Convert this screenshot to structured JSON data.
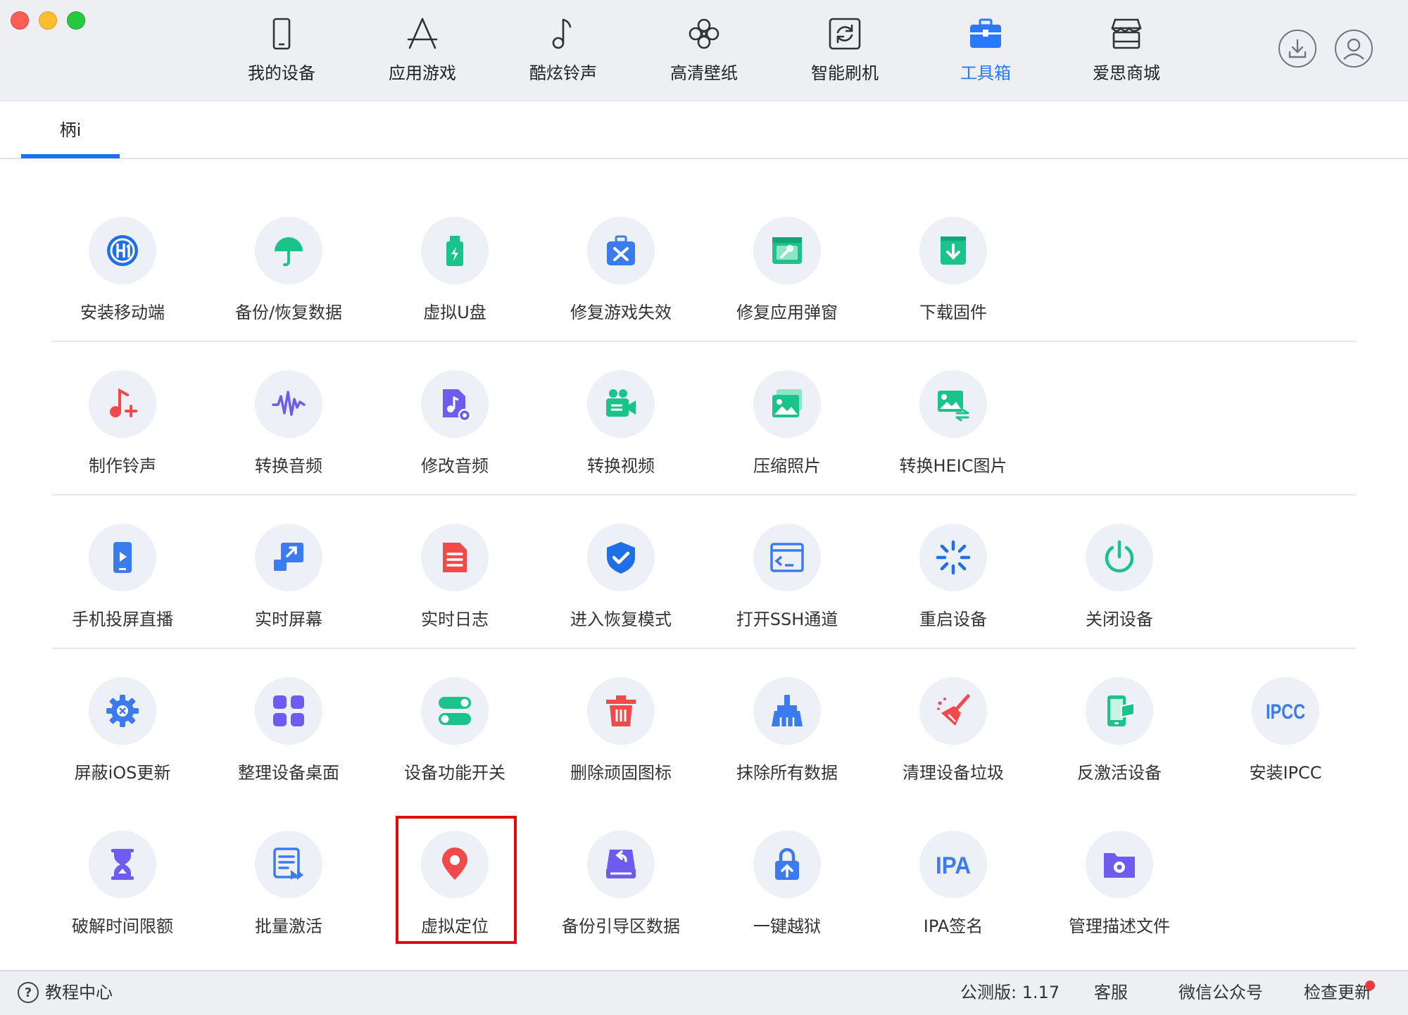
{
  "nav": {
    "items": [
      {
        "label": "我的设备",
        "icon": "phone-icon"
      },
      {
        "label": "应用游戏",
        "icon": "app-store-icon"
      },
      {
        "label": "酷炫铃声",
        "icon": "music-note-icon"
      },
      {
        "label": "高清壁纸",
        "icon": "flower-icon"
      },
      {
        "label": "智能刷机",
        "icon": "refresh-box-icon"
      },
      {
        "label": "工具箱",
        "icon": "toolbox-icon",
        "active": true
      },
      {
        "label": "爱思商城",
        "icon": "store-icon"
      }
    ],
    "active_color": "#2979ff"
  },
  "header_icons": [
    "download-icon",
    "user-avatar-icon"
  ],
  "tabs": [
    {
      "label": "柄i"
    }
  ],
  "tools": {
    "rows": [
      [
        {
          "label": "安装移动端",
          "icon": "i4-logo-icon",
          "color": "#1f6fe6"
        },
        {
          "label": "备份/恢复数据",
          "icon": "umbrella-icon",
          "color": "#19c38a"
        },
        {
          "label": "虚拟U盘",
          "icon": "usb-drive-icon",
          "color": "#19c38a"
        },
        {
          "label": "修复游戏失效",
          "icon": "repair-kit-icon",
          "color": "#3a7bf0"
        },
        {
          "label": "修复应用弹窗",
          "icon": "window-wrench-icon",
          "color": "#19c38a"
        },
        {
          "label": "下载固件",
          "icon": "download-box-icon",
          "color": "#19c38a"
        }
      ],
      [
        {
          "label": "制作铃声",
          "icon": "ringtone-add-icon",
          "color": "#f24a4a"
        },
        {
          "label": "转换音频",
          "icon": "waveform-icon",
          "color": "#6e5bf0"
        },
        {
          "label": "修改音频",
          "icon": "audio-file-gear-icon",
          "color": "#6e5bf0"
        },
        {
          "label": "转换视频",
          "icon": "video-camera-icon",
          "color": "#19c38a"
        },
        {
          "label": "压缩照片",
          "icon": "photos-icon",
          "color": "#19c38a"
        },
        {
          "label": "转换HEIC图片",
          "icon": "image-convert-icon",
          "color": "#19c38a"
        }
      ],
      [
        {
          "label": "手机投屏直播",
          "icon": "phone-cast-icon",
          "color": "#3a7bf0"
        },
        {
          "label": "实时屏幕",
          "icon": "screen-mirror-icon",
          "color": "#3a7bf0"
        },
        {
          "label": "实时日志",
          "icon": "log-document-icon",
          "color": "#f24a4a"
        },
        {
          "label": "进入恢复模式",
          "icon": "shield-check-icon",
          "color": "#1f6fe6"
        },
        {
          "label": "打开SSH通道",
          "icon": "terminal-icon",
          "color": "#3a7bf0"
        },
        {
          "label": "重启设备",
          "icon": "restart-spinner-icon",
          "color": "#1f6fe6"
        },
        {
          "label": "关闭设备",
          "icon": "power-icon",
          "color": "#19c38a"
        }
      ],
      [
        {
          "label": "屏蔽iOS更新",
          "icon": "gear-block-icon",
          "color": "#3a7bf0"
        },
        {
          "label": "整理设备桌面",
          "icon": "grid-apps-icon",
          "color": "#6e5bf0"
        },
        {
          "label": "设备功能开关",
          "icon": "toggle-switch-icon",
          "color": "#19c38a"
        },
        {
          "label": "删除顽固图标",
          "icon": "trash-icon",
          "color": "#f24a4a"
        },
        {
          "label": "抹除所有数据",
          "icon": "broom-icon",
          "color": "#3a7bf0"
        },
        {
          "label": "清理设备垃圾",
          "icon": "sweep-brush-icon",
          "color": "#f24a4a"
        },
        {
          "label": "反激活设备",
          "icon": "phone-flag-icon",
          "color": "#19c38a"
        },
        {
          "label": "安装IPCC",
          "icon": "ipcc-text-icon",
          "color": "#3a7bf0"
        }
      ],
      [
        {
          "label": "破解时间限额",
          "icon": "hourglass-icon",
          "color": "#6e5bf0"
        },
        {
          "label": "批量激活",
          "icon": "batch-list-icon",
          "color": "#3a7bf0"
        },
        {
          "label": "虚拟定位",
          "icon": "location-pin-icon",
          "color": "#f24a4a"
        },
        {
          "label": "备份引导区数据",
          "icon": "drive-backup-icon",
          "color": "#6e5bf0"
        },
        {
          "label": "一键越狱",
          "icon": "unlock-icon",
          "color": "#3a7bf0"
        },
        {
          "label": "IPA签名",
          "icon": "ipa-text-icon",
          "color": "#3a7bf0"
        },
        {
          "label": "管理描述文件",
          "icon": "folder-gear-icon",
          "color": "#6e5bf0"
        }
      ]
    ],
    "circle_bg": "#eef0f8",
    "highlight_color": "#e3080a"
  },
  "footer": {
    "help_label": "教程中心",
    "version": "公测版: 1.17",
    "service": "客服",
    "wechat": "微信公众号",
    "update": "检查更新"
  }
}
